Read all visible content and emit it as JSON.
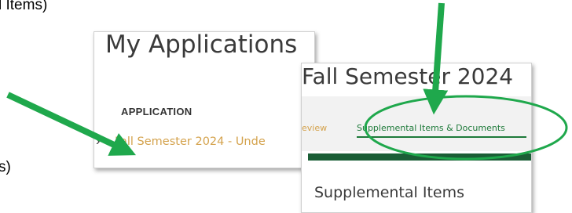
{
  "doc_text": {
    "top_fragment": "l Items)",
    "bottom_fragment": "s)"
  },
  "my_applications": {
    "title": "My Applications",
    "column_header": "APPLICATION",
    "chevron": "›",
    "application_link": "Fall Semester 2024 - Unde"
  },
  "application_page": {
    "title": "Fall Semester 2024",
    "tabs": [
      {
        "label": "eview"
      },
      {
        "label": "Supplemental Items & Documents"
      }
    ],
    "section_title": "Supplemental Items"
  },
  "annotation": {
    "arrow_color": "#1fa84c",
    "ellipse_color": "#1fa84c"
  }
}
